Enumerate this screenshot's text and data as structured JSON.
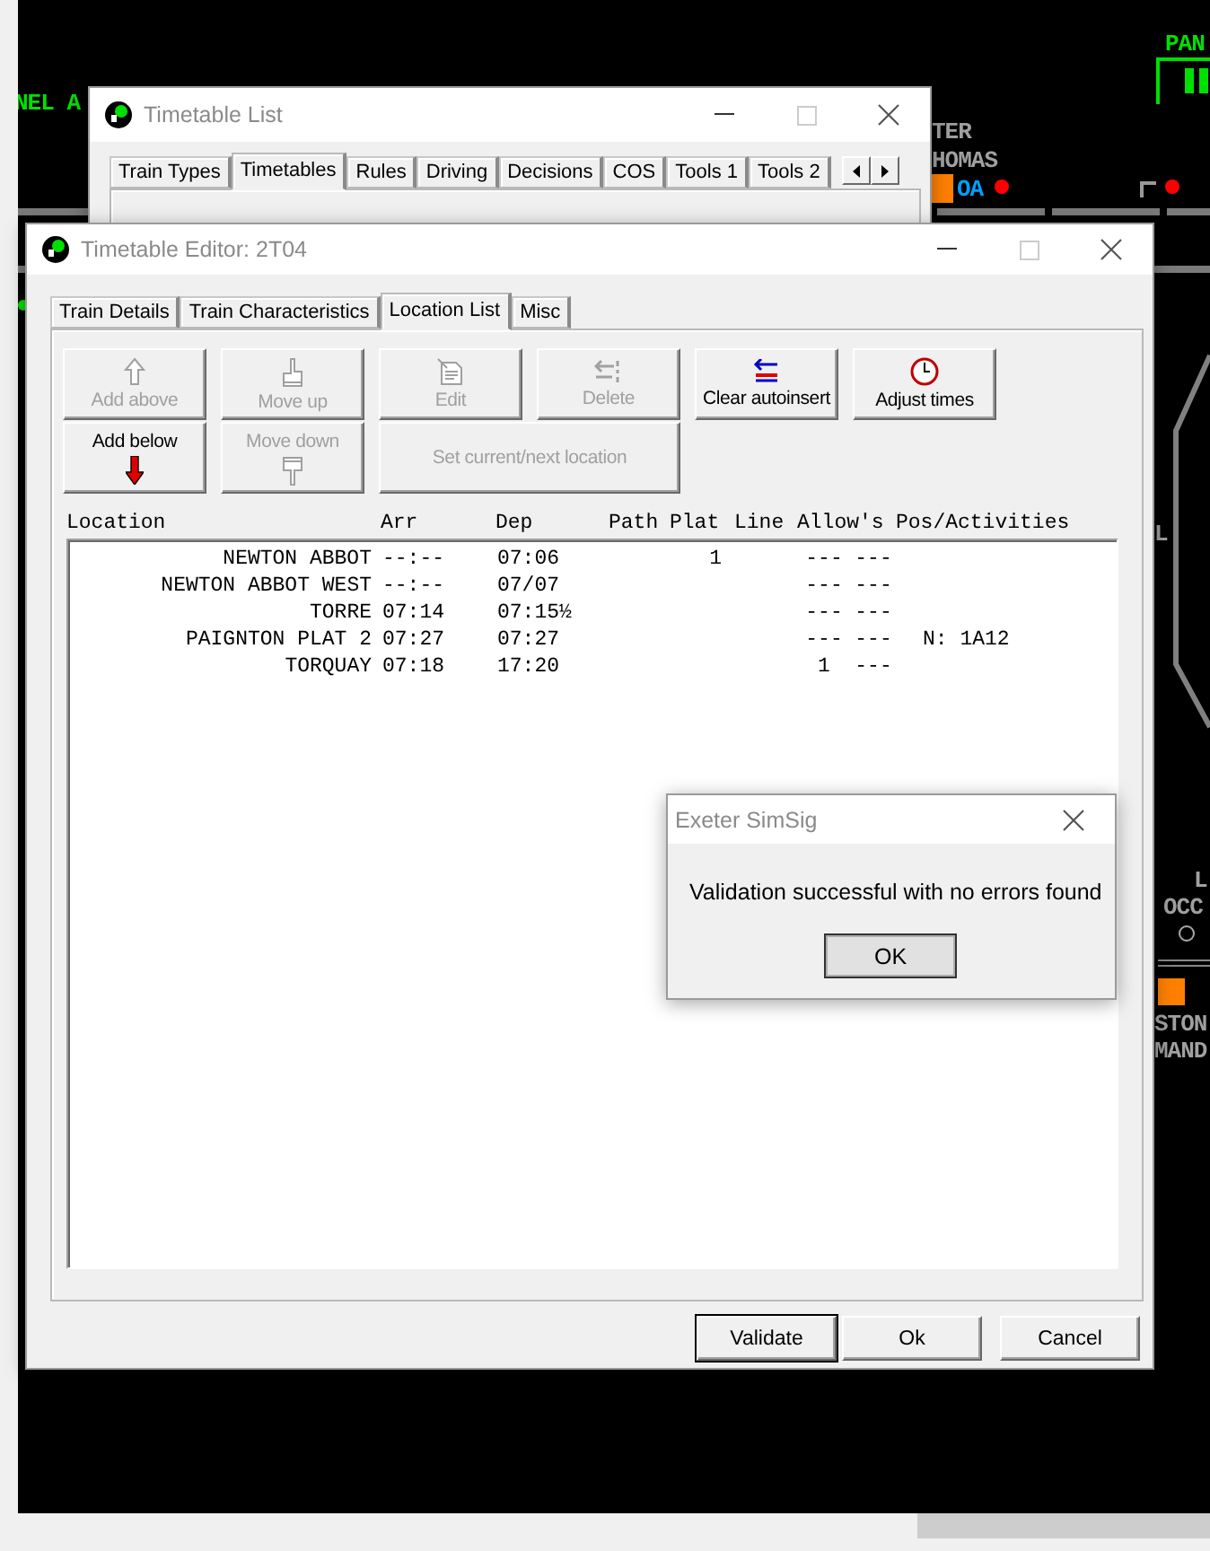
{
  "desktop": {
    "labels": [
      {
        "text": "NEL A",
        "color": "#00e000"
      },
      {
        "text": "PAN",
        "color": "#00e000"
      },
      {
        "text": "TER",
        "color": "#a0a0a0"
      },
      {
        "text": "HOMAS",
        "color": "#a0a0a0"
      },
      {
        "text": "OA",
        "color": "#00a0ff"
      },
      {
        "text": "L",
        "color": "#a0a0a0"
      },
      {
        "text": "L",
        "color": "#a0a0a0"
      },
      {
        "text": "OCC",
        "color": "#a0a0a0"
      },
      {
        "text": "STON",
        "color": "#a0a0a0"
      },
      {
        "text": "MAND",
        "color": "#a0a0a0"
      }
    ]
  },
  "timetable_list": {
    "title": "Timetable List",
    "tabs": [
      {
        "label": "Train Types",
        "selected": false
      },
      {
        "label": "Timetables",
        "selected": true
      },
      {
        "label": "Rules",
        "selected": false
      },
      {
        "label": "Driving",
        "selected": false
      },
      {
        "label": "Decisions",
        "selected": false
      },
      {
        "label": "COS",
        "selected": false
      },
      {
        "label": "Tools 1",
        "selected": false
      },
      {
        "label": "Tools 2",
        "selected": false
      }
    ]
  },
  "editor": {
    "title": "Timetable Editor: 2T04",
    "tabs": [
      {
        "label": "Train Details",
        "selected": false
      },
      {
        "label": "Train Characteristics",
        "selected": false
      },
      {
        "label": "Location List",
        "selected": true
      },
      {
        "label": "Misc",
        "selected": false
      }
    ],
    "buttons": [
      {
        "label": "Add above",
        "disabled": true
      },
      {
        "label": "Move up",
        "disabled": true
      },
      {
        "label": "Edit",
        "disabled": true
      },
      {
        "label": "Delete",
        "disabled": true
      },
      {
        "label": "Clear autoinsert",
        "disabled": false
      },
      {
        "label": "Adjust times",
        "disabled": false
      },
      {
        "label": "Add below",
        "disabled": false
      },
      {
        "label": "Move down",
        "disabled": true
      },
      {
        "label": "Set current/next location",
        "disabled": true
      }
    ],
    "columns": [
      "Location",
      "Arr",
      "Dep",
      "Path",
      "Plat",
      "Line",
      "Allow's",
      "Pos/Activities"
    ],
    "rows": [
      {
        "location": "NEWTON ABBOT",
        "arr": "--:--",
        "dep": "07:06",
        "plat": "1",
        "allow_1": "---",
        "allow_2": "---"
      },
      {
        "location": "NEWTON ABBOT WEST",
        "arr": "--:--",
        "dep": "07/07",
        "allow_1": "---",
        "allow_2": "---"
      },
      {
        "location": "TORRE",
        "arr": "07:14",
        "dep": "07:15½",
        "allow_1": "---",
        "allow_2": "---"
      },
      {
        "location": "PAIGNTON PLAT 2",
        "arr": "07:27",
        "dep": "07:27",
        "allow_1": "---",
        "allow_2": "---",
        "pos": "N: 1A12"
      },
      {
        "location": "TORQUAY",
        "arr": "07:18",
        "dep": "17:20",
        "allow_1": "1",
        "allow_2": "---"
      }
    ],
    "footer_buttons": [
      "Validate",
      "Ok",
      "Cancel"
    ]
  },
  "message_box": {
    "title": "Exeter SimSig",
    "message": "Validation successful with no errors found",
    "button": "OK"
  }
}
